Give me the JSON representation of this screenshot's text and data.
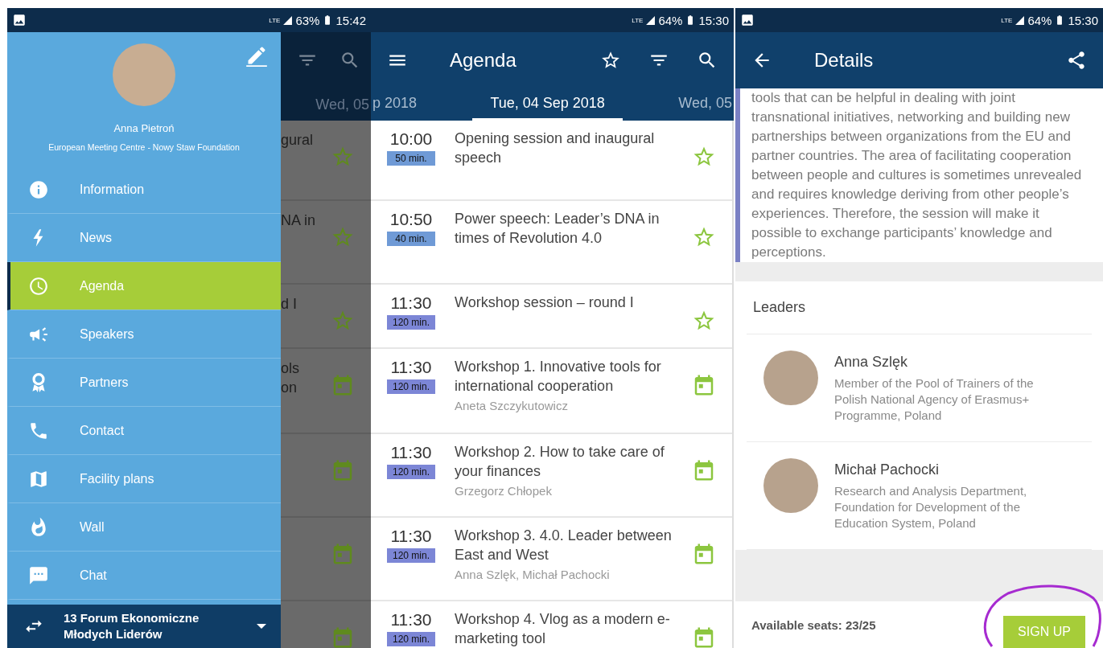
{
  "drawer_screen": {
    "status_bar": {
      "notification_icon": true,
      "network": "LTE",
      "battery": "63%",
      "time": "15:42"
    },
    "background": {
      "date_tab": "Wed, 05",
      "rows": [
        {
          "lines": [
            "gural"
          ],
          "kind": "star"
        },
        {
          "lines": [
            "NA in"
          ],
          "kind": "star"
        },
        {
          "lines": [
            "d I"
          ],
          "kind": "star"
        },
        {
          "lines": [
            "ols",
            "on"
          ],
          "kind": "calendar"
        },
        {
          "kind": "calendar"
        },
        {
          "kind": "calendar"
        },
        {
          "kind": "calendar"
        }
      ]
    },
    "profile": {
      "name": "Anna Pietroń",
      "organization": "European Meeting Centre - Nowy Staw Foundation"
    },
    "menu": [
      {
        "label": "Information",
        "kind": "info",
        "selected": false
      },
      {
        "label": "News",
        "kind": "bolt",
        "selected": false
      },
      {
        "label": "Agenda",
        "kind": "clock",
        "selected": true
      },
      {
        "label": "Speakers",
        "kind": "megaphone",
        "selected": false
      },
      {
        "label": "Partners",
        "kind": "award",
        "selected": false
      },
      {
        "label": "Contact",
        "kind": "phone",
        "selected": false
      },
      {
        "label": "Facility plans",
        "kind": "map",
        "selected": false
      },
      {
        "label": "Wall",
        "kind": "flame",
        "selected": false
      },
      {
        "label": "Chat",
        "kind": "chat",
        "selected": false
      }
    ],
    "event_switcher": {
      "title": "13 Forum Ekonomiczne Młodych Liderów"
    }
  },
  "agenda_screen": {
    "status_bar": {
      "notification_icon": false,
      "network": "LTE",
      "battery": "64%",
      "time": "15:30"
    },
    "title": "Agenda",
    "date_tabs": [
      {
        "label": "p 2018",
        "selected": false
      },
      {
        "label": "Tue, 04 Sep 2018",
        "selected": true
      },
      {
        "label": "Wed, 05",
        "selected": false
      }
    ],
    "sessions": [
      {
        "time": "10:00",
        "duration": "50 min.",
        "color": "#6f9ad6",
        "title": "Opening session and inaugural speech",
        "kind": "star"
      },
      {
        "time": "10:50",
        "duration": "40 min.",
        "color": "#6f9ad6",
        "title": "Power speech: Leader’s DNA in times of Revolution 4.0",
        "kind": "star"
      },
      {
        "time": "11:30",
        "duration": "120 min.",
        "color": "#7c86d6",
        "title": "Workshop session – round I",
        "kind": "star"
      },
      {
        "time": "11:30",
        "duration": "120 min.",
        "color": "#7c86d6",
        "title": "Workshop 1. Innovative tools for international cooperation",
        "speakers": "Aneta Szczykutowicz",
        "kind": "calendar"
      },
      {
        "time": "11:30",
        "duration": "120 min.",
        "color": "#7c86d6",
        "title": "Workshop 2. How to take care of your finances",
        "speakers": "Grzegorz Chłopek",
        "kind": "calendar"
      },
      {
        "time": "11:30",
        "duration": "120 min.",
        "color": "#7c86d6",
        "title": "Workshop 3. 4.0. Leader between East and West",
        "speakers": "Anna Szlęk, Michał Pachocki",
        "kind": "calendar"
      },
      {
        "time": "11:30",
        "duration": "120 min.",
        "color": "#7c86d6",
        "title": "Workshop 4. Vlog as a modern e-marketing tool",
        "kind": "calendar"
      }
    ]
  },
  "details_screen": {
    "status_bar": {
      "notification_icon": true,
      "network": "LTE",
      "battery": "64%",
      "time": "15:30"
    },
    "title": "Details",
    "description": "tools that can be helpful in dealing with joint transnational initiatives, networking and building new partnerships between organizations from the EU and partner countries. The area of facilitating cooperation between people and cultures is sometimes unrevealed and requires knowledge deriving from other people’s experiences. Therefore, the session will make it possible to exchange participants’ knowledge and perceptions.",
    "leaders_heading": "Leaders",
    "leaders": [
      {
        "name": "Anna Szlęk",
        "role": "Member of the Pool of Trainers of the Polish National Agency of Erasmus+ Programme, Poland"
      },
      {
        "name": "Michał Pachocki",
        "role": "Research and Analysis Department, Foundation for Development of the Education System, Poland"
      }
    ],
    "seats": "Available seats: 23/25",
    "sign_up_button": "SIGN UP",
    "annotation_circle": true
  }
}
